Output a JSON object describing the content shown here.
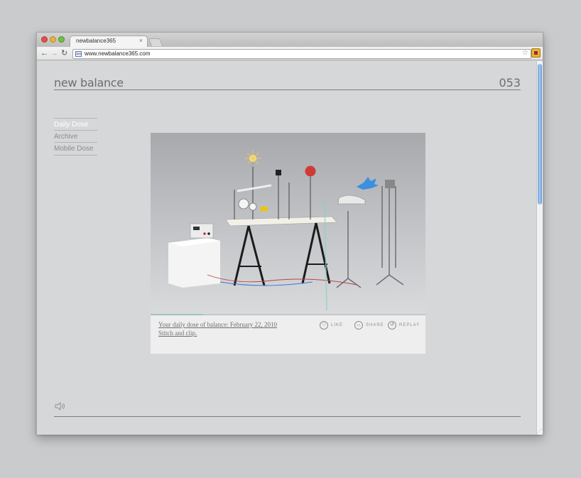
{
  "browser": {
    "tab_title": "newbalance365",
    "tab_close": "×",
    "url": "www.newbalance365.com",
    "favicon_text": "365"
  },
  "site": {
    "logo": "new balance",
    "issue_number": "053",
    "menu": [
      {
        "label": "Daily Dose",
        "active": true
      },
      {
        "label": "Archive",
        "active": false
      },
      {
        "label": "Mobile Dose",
        "active": false
      }
    ]
  },
  "card": {
    "caption_line1": "Your daily dose of balance: February 22, 2010",
    "caption_line2": "Stitch and clip.",
    "progress_fraction": 0.19,
    "actions": [
      {
        "label": "LIKE",
        "icon": "heart-icon",
        "glyph": "♡"
      },
      {
        "label": "SHARE",
        "icon": "share-icon",
        "glyph": "↔"
      },
      {
        "label": "REPLAY",
        "icon": "replay-icon",
        "glyph": "↺"
      }
    ]
  },
  "colors": {
    "page_bg": "#d6d7d8",
    "text_gray": "#6d6e70",
    "scroll_blue": "#6ea4dc"
  }
}
